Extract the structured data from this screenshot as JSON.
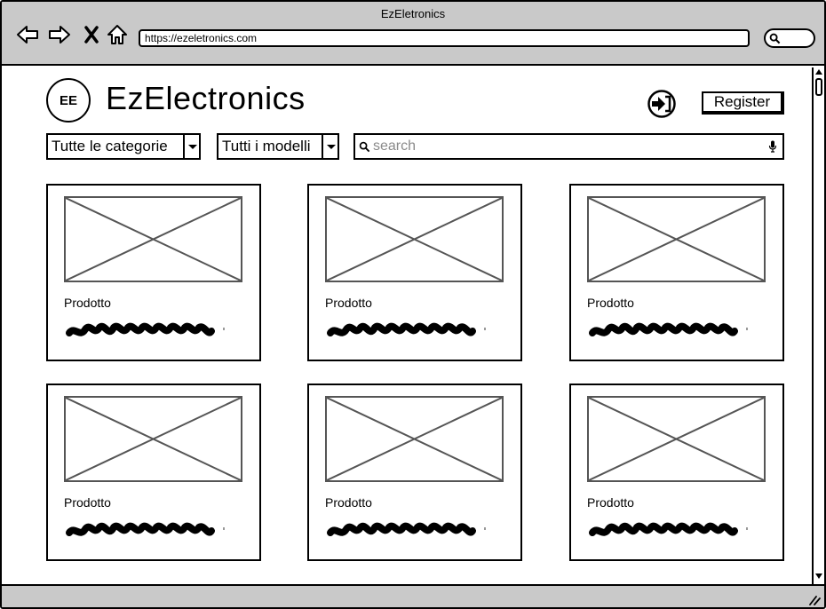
{
  "window": {
    "title": "EzEletronics"
  },
  "toolbar": {
    "url": "https://ezeletronics.com"
  },
  "header": {
    "logo_text": "EE",
    "brand": "EzElectronics",
    "register_label": "Register"
  },
  "filters": {
    "category": "Tutte le categorie",
    "model": "Tutti i modelli",
    "search_placeholder": "search"
  },
  "products": [
    {
      "title": "Prodotto"
    },
    {
      "title": "Prodotto"
    },
    {
      "title": "Prodotto"
    },
    {
      "title": "Prodotto"
    },
    {
      "title": "Prodotto"
    },
    {
      "title": "Prodotto"
    }
  ]
}
